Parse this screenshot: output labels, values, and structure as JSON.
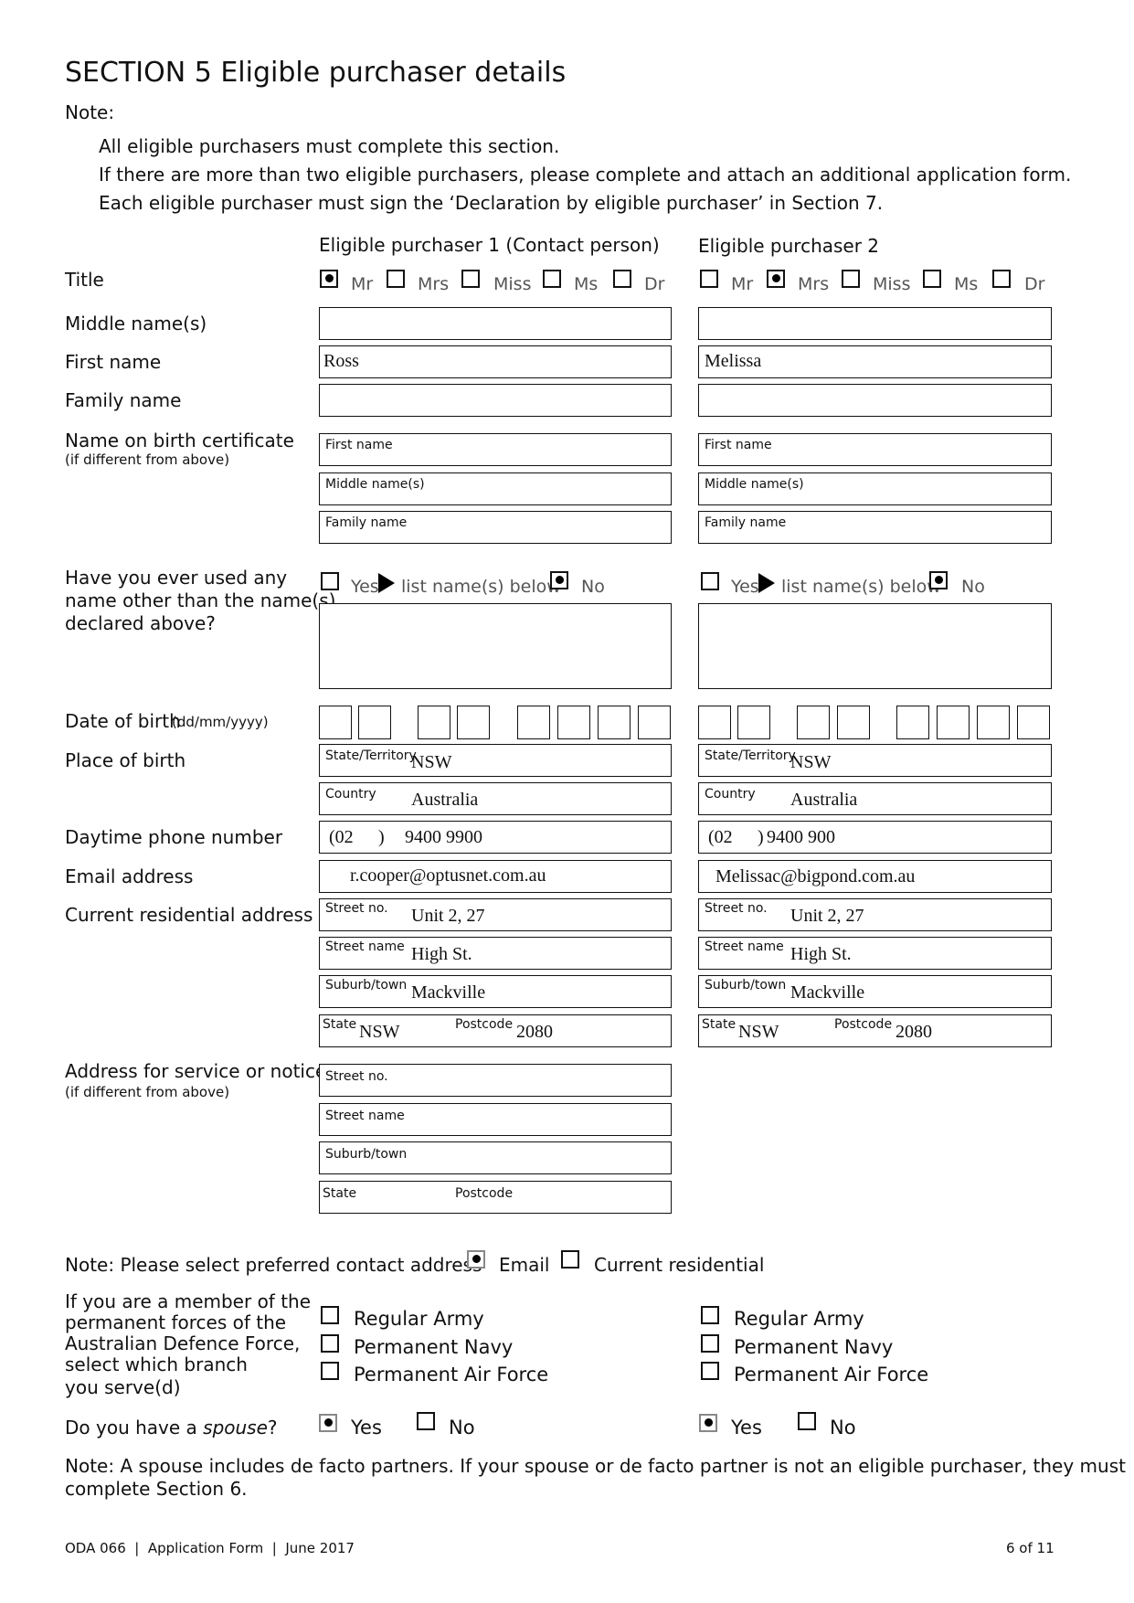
{
  "section": {
    "title": "SECTION 5   Eligible purchaser details",
    "note_label": "Note:",
    "notes": [
      "All eligible purchasers must complete this section.",
      "If there are more than two eligible purchasers, please complete and attach an additional application form.",
      "Each eligible purchaser must sign the ‘Declaration by eligible purchaser’ in Section 7."
    ]
  },
  "columns": {
    "p1": "Eligible purchaser 1 (Contact person)",
    "p2": "Eligible purchaser 2"
  },
  "labels": {
    "title": "Title",
    "middle_names": "Middle name(s)",
    "first_name": "First name",
    "family_name": "Family name",
    "birth_cert": "Name on birth certificate",
    "birth_cert_sub": "(if different from above)",
    "other_names_1": "Have you ever used any",
    "other_names_2": "name other than the name(s)",
    "other_names_3": "declared above?",
    "dob": "Date of birth",
    "dob_format": "(dd/mm/yyyy)",
    "place_of_birth": "Place of birth",
    "phone": "Daytime phone number",
    "email": "Email address",
    "residential": "Current residential address",
    "service_address": "Address for service or notices",
    "service_address_sub": "(if different from above)",
    "adf_1": "If you are a member of the",
    "adf_2": "permanent forces of the",
    "adf_3": "Australian Defence Force,",
    "adf_4": "select which branch",
    "adf_5": "you serve(d)",
    "spouse_prefix": "Do you have a ",
    "spouse_em": "spouse",
    "spouse_suffix": "?"
  },
  "field_labels": {
    "first_name": "First name",
    "middle_names": "Middle name(s)",
    "family_name": "Family name",
    "state_territory": "State/Territory",
    "country": "Country",
    "street_no": "Street no.",
    "street_name": "Street name",
    "suburb": "Suburb/town",
    "state": "State",
    "postcode": "Postcode"
  },
  "title_options": [
    "Mr",
    "Mrs",
    "Miss",
    "Ms",
    "Dr"
  ],
  "other_names_options": {
    "yes": "Yes",
    "list": "list name(s) below",
    "no": "No"
  },
  "purchasers": [
    {
      "title_selected": "Mr",
      "middle_names": "",
      "first_name": "Ross",
      "family_name": "",
      "other_names_used": "No",
      "pob_state": "NSW",
      "pob_country": "Australia",
      "phone_area": "(02",
      "phone_close": ")",
      "phone_number": "9400 9900",
      "email": "r.cooper@optusnet.com.au",
      "street_no": "Unit 2, 27",
      "street_name": "High St.",
      "suburb": "Mackville",
      "state": "NSW",
      "postcode": "2080",
      "has_spouse": "Yes"
    },
    {
      "title_selected": "Mrs",
      "middle_names": "",
      "first_name": "Melissa",
      "family_name": "",
      "other_names_used": "No",
      "pob_state": "NSW",
      "pob_country": "Australia",
      "phone_area": "(02",
      "phone_close": ")",
      "phone_number": "9400 900",
      "email": "Melissac@bigpond.com.au",
      "street_no": "Unit 2, 27",
      "street_name": "High St.",
      "suburb": "Mackville",
      "state": "NSW",
      "postcode": "2080",
      "has_spouse": "Yes"
    }
  ],
  "contact_note": {
    "text": "Note: Please select preferred contact address",
    "options": [
      "Email",
      "Current residential"
    ],
    "selected": "Email"
  },
  "adf_options": [
    "Regular Army",
    "Permanent Navy",
    "Permanent Air Force"
  ],
  "spouse_options": [
    "Yes",
    "No"
  ],
  "spouse_note_1": "Note: A spouse includes de facto partners. If your spouse or de facto partner is not an eligible purchaser, they must",
  "spouse_note_2": "complete Section 6.",
  "footer": {
    "left": "ODA 066  |  Application Form  |  June 2017",
    "right": "6 of 11"
  }
}
